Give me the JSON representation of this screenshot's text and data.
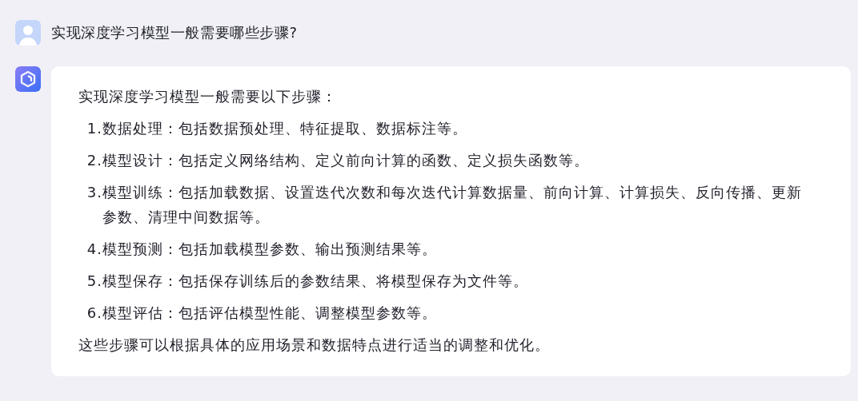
{
  "question": {
    "text": "实现深度学习模型一般需要哪些步骤?"
  },
  "answer": {
    "intro": "实现深度学习模型一般需要以下步骤：",
    "steps": [
      {
        "number": "1.",
        "text": "数据处理：包括数据预处理、特征提取、数据标注等。"
      },
      {
        "number": "2.",
        "text": "模型设计：包括定义网络结构、定义前向计算的函数、定义损失函数等。"
      },
      {
        "number": "3.",
        "text": "模型训练：包括加载数据、设置迭代次数和每次迭代计算数据量、前向计算、计算损失、反向传播、更新参数、清理中间数据等。"
      },
      {
        "number": "4.",
        "text": "模型预测：包括加载模型参数、输出预测结果等。"
      },
      {
        "number": "5.",
        "text": "模型保存：包括保存训练后的参数结果、将模型保存为文件等。"
      },
      {
        "number": "6.",
        "text": "模型评估：包括评估模型性能、调整模型参数等。"
      }
    ],
    "conclusion": "这些步骤可以根据具体的应用场景和数据特点进行适当的调整和优化。"
  }
}
